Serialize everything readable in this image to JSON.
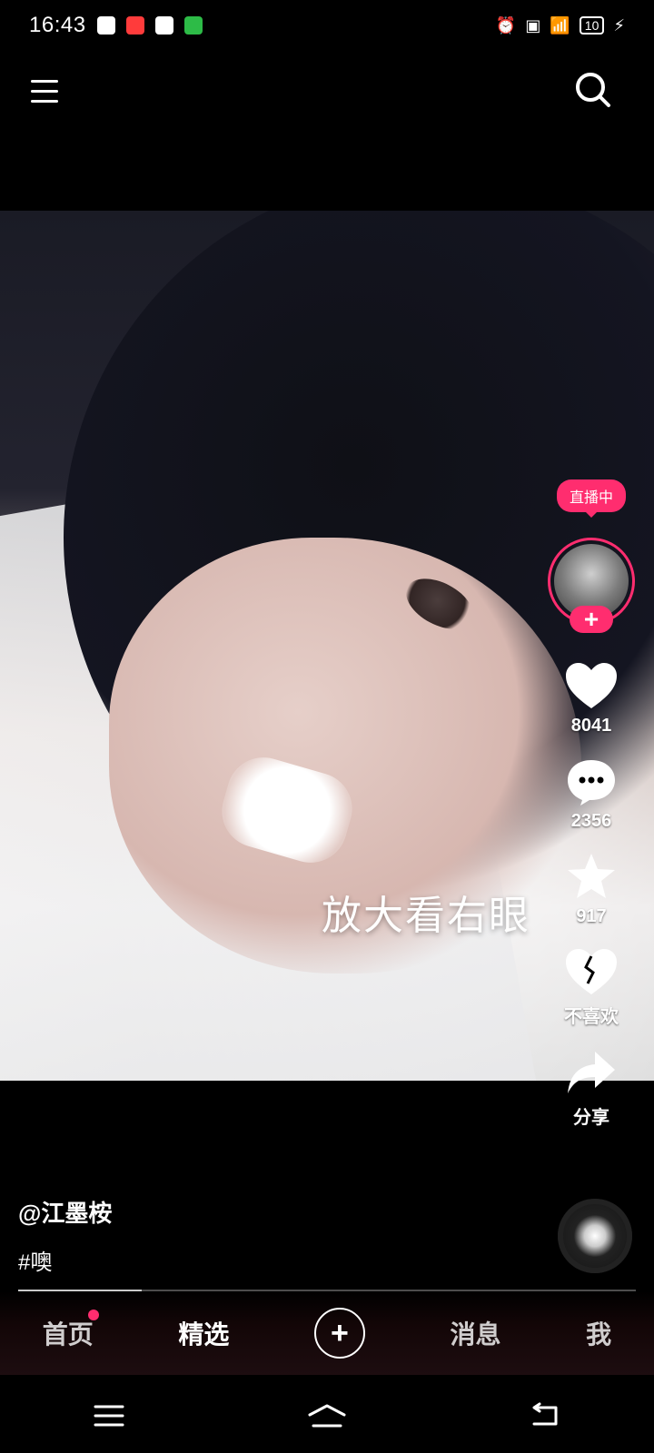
{
  "status": {
    "time": "16:43",
    "battery": "10"
  },
  "icons": {
    "menu": "menu-icon",
    "search": "search-icon",
    "heart": "heart-icon",
    "comment": "comment-icon",
    "star": "star-icon",
    "dislike": "broken-heart-icon",
    "share": "share-icon",
    "plus": "plus-icon"
  },
  "video": {
    "caption": "放大看右眼",
    "progress_fraction": 0.2
  },
  "creator": {
    "live_badge": "直播中",
    "follow_plus": "+",
    "handle": "@江墨桉",
    "hashtag": "#噢"
  },
  "actions": {
    "likes": "8041",
    "comments": "2356",
    "favorites": "917",
    "dislike_label": "不喜欢",
    "share_label": "分享"
  },
  "tabs": {
    "home": "首页",
    "featured": "精选",
    "create": "+",
    "messages": "消息",
    "me": "我"
  },
  "colors": {
    "accent": "#ff2d6f",
    "background": "#000000"
  }
}
